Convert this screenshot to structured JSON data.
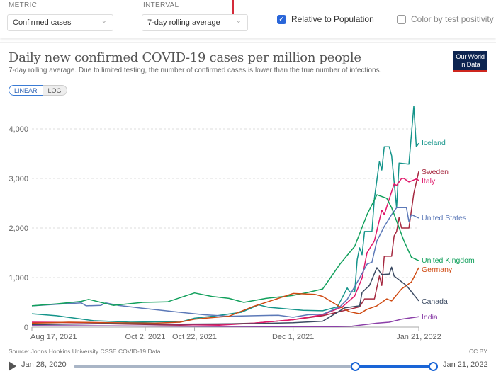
{
  "controls": {
    "metric_label": "METRIC",
    "metric_value": "Confirmed cases",
    "interval_label": "INTERVAL",
    "interval_value": "7-day rolling average",
    "relative_label": "Relative to Population",
    "relative_checked": true,
    "positivity_label": "Color by test positivity",
    "positivity_checked": false
  },
  "logo": {
    "line1": "Our World",
    "line2": "in Data"
  },
  "scale_toggle": {
    "linear": "LINEAR",
    "log": "LOG",
    "active": "LINEAR"
  },
  "footer": {
    "source": "Source: Johns Hopkins University CSSE COVID-19 Data",
    "license": "CC BY"
  },
  "timeline": {
    "start": "Jan 28, 2020",
    "end": "Jan 21, 2022",
    "selected_start": "Aug 17, 2021",
    "selected_end": "Jan 21, 2022"
  },
  "chart_data": {
    "type": "line",
    "title": "Daily new confirmed COVID-19 cases per million people",
    "subtitle": "7-day rolling average. Due to limited testing, the number of confirmed cases is lower than the true number of infections.",
    "xlim": [
      "2021-08-17",
      "2022-01-21"
    ],
    "ylim": [
      0,
      4500
    ],
    "yticks": [
      {
        "v": 0,
        "label": "0"
      },
      {
        "v": 1000,
        "label": "1,000"
      },
      {
        "v": 2000,
        "label": "2,000"
      },
      {
        "v": 3000,
        "label": "3,000"
      },
      {
        "v": 4000,
        "label": "4,000"
      }
    ],
    "xticks": [
      {
        "d": "2021-08-17",
        "label": "Aug 17, 2021"
      },
      {
        "d": "2021-10-02",
        "label": "Oct 2, 2021"
      },
      {
        "d": "2021-10-22",
        "label": "Oct 22, 2021"
      },
      {
        "d": "2021-12-01",
        "label": "Dec 1, 2021"
      },
      {
        "d": "2022-01-21",
        "label": "Jan 21, 2022"
      }
    ],
    "grid": true,
    "legend": "right (end labels)",
    "series": [
      {
        "name": "Iceland",
        "color": "#14948a",
        "points": [
          [
            "2021-08-17",
            270
          ],
          [
            "2021-08-27",
            230
          ],
          [
            "2021-09-11",
            130
          ],
          [
            "2021-09-26",
            100
          ],
          [
            "2021-10-11",
            110
          ],
          [
            "2021-10-16",
            100
          ],
          [
            "2021-10-22",
            180
          ],
          [
            "2021-10-31",
            230
          ],
          [
            "2021-11-10",
            300
          ],
          [
            "2021-11-17",
            450
          ],
          [
            "2021-11-21",
            400
          ],
          [
            "2021-12-05",
            340
          ],
          [
            "2021-12-13",
            330
          ],
          [
            "2021-12-19",
            410
          ],
          [
            "2021-12-23",
            790
          ],
          [
            "2021-12-24",
            710
          ],
          [
            "2021-12-26",
            710
          ],
          [
            "2021-12-27",
            1360
          ],
          [
            "2021-12-28",
            1600
          ],
          [
            "2021-12-29",
            1460
          ],
          [
            "2021-12-30",
            1930
          ],
          [
            "2022-01-02",
            1930
          ],
          [
            "2022-01-03",
            2600
          ],
          [
            "2022-01-05",
            3340
          ],
          [
            "2022-01-06",
            3170
          ],
          [
            "2022-01-07",
            3640
          ],
          [
            "2022-01-09",
            3640
          ],
          [
            "2022-01-10",
            3460
          ],
          [
            "2022-01-12",
            2410
          ],
          [
            "2022-01-13",
            3310
          ],
          [
            "2022-01-17",
            3290
          ],
          [
            "2022-01-19",
            4460
          ],
          [
            "2022-01-20",
            3640
          ],
          [
            "2022-01-21",
            3710
          ]
        ]
      },
      {
        "name": "Sweden",
        "color": "#a5283f",
        "points": [
          [
            "2021-08-17",
            60
          ],
          [
            "2021-09-16",
            70
          ],
          [
            "2021-10-16",
            40
          ],
          [
            "2021-11-15",
            80
          ],
          [
            "2021-12-01",
            150
          ],
          [
            "2021-12-13",
            230
          ],
          [
            "2021-12-28",
            410
          ],
          [
            "2021-12-30",
            570
          ],
          [
            "2022-01-03",
            570
          ],
          [
            "2022-01-05",
            1030
          ],
          [
            "2022-01-06",
            840
          ],
          [
            "2022-01-07",
            1430
          ],
          [
            "2022-01-10",
            1430
          ],
          [
            "2022-01-11",
            1840
          ],
          [
            "2022-01-12",
            1930
          ],
          [
            "2022-01-13",
            2210
          ],
          [
            "2022-01-14",
            2000
          ],
          [
            "2022-01-17",
            2000
          ],
          [
            "2022-01-19",
            2700
          ],
          [
            "2022-01-21",
            3140
          ]
        ]
      },
      {
        "name": "Italy",
        "color": "#e0186a",
        "points": [
          [
            "2021-08-17",
            100
          ],
          [
            "2021-09-16",
            90
          ],
          [
            "2021-10-16",
            50
          ],
          [
            "2021-11-01",
            40
          ],
          [
            "2021-11-15",
            80
          ],
          [
            "2021-12-01",
            150
          ],
          [
            "2021-12-13",
            250
          ],
          [
            "2021-12-21",
            410
          ],
          [
            "2021-12-26",
            630
          ],
          [
            "2021-12-29",
            990
          ],
          [
            "2021-12-31",
            1500
          ],
          [
            "2022-01-03",
            1740
          ],
          [
            "2022-01-06",
            2360
          ],
          [
            "2022-01-07",
            2270
          ],
          [
            "2022-01-11",
            2890
          ],
          [
            "2022-01-12",
            2860
          ],
          [
            "2022-01-14",
            3000
          ],
          [
            "2022-01-15",
            3000
          ],
          [
            "2022-01-17",
            2930
          ],
          [
            "2022-01-20",
            2990
          ],
          [
            "2022-01-21",
            2960
          ]
        ]
      },
      {
        "name": "United States",
        "color": "#5c79b8",
        "points": [
          [
            "2021-08-17",
            430
          ],
          [
            "2021-08-27",
            460
          ],
          [
            "2021-09-06",
            490
          ],
          [
            "2021-09-08",
            430
          ],
          [
            "2021-09-14",
            440
          ],
          [
            "2021-09-16",
            490
          ],
          [
            "2021-09-21",
            440
          ],
          [
            "2021-10-01",
            380
          ],
          [
            "2021-10-16",
            300
          ],
          [
            "2021-10-26",
            250
          ],
          [
            "2021-11-05",
            220
          ],
          [
            "2021-11-15",
            230
          ],
          [
            "2021-11-25",
            240
          ],
          [
            "2021-12-01",
            200
          ],
          [
            "2021-12-07",
            250
          ],
          [
            "2021-12-13",
            260
          ],
          [
            "2021-12-20",
            410
          ],
          [
            "2021-12-23",
            560
          ],
          [
            "2021-12-28",
            990
          ],
          [
            "2021-12-31",
            1270
          ],
          [
            "2022-01-02",
            1310
          ],
          [
            "2022-01-04",
            1740
          ],
          [
            "2022-01-07",
            2030
          ],
          [
            "2022-01-10",
            2270
          ],
          [
            "2022-01-12",
            2410
          ],
          [
            "2022-01-16",
            2410
          ],
          [
            "2022-01-17",
            2130
          ],
          [
            "2022-01-18",
            2270
          ],
          [
            "2022-01-21",
            2200
          ]
        ]
      },
      {
        "name": "United Kingdom",
        "color": "#12a05c",
        "points": [
          [
            "2021-08-17",
            430
          ],
          [
            "2021-08-27",
            470
          ],
          [
            "2021-09-06",
            520
          ],
          [
            "2021-09-09",
            560
          ],
          [
            "2021-09-14",
            500
          ],
          [
            "2021-09-19",
            440
          ],
          [
            "2021-10-01",
            500
          ],
          [
            "2021-10-11",
            510
          ],
          [
            "2021-10-22",
            690
          ],
          [
            "2021-10-29",
            620
          ],
          [
            "2021-11-05",
            580
          ],
          [
            "2021-11-11",
            500
          ],
          [
            "2021-11-20",
            580
          ],
          [
            "2021-12-01",
            640
          ],
          [
            "2021-12-07",
            700
          ],
          [
            "2021-12-13",
            770
          ],
          [
            "2021-12-20",
            1270
          ],
          [
            "2021-12-26",
            1630
          ],
          [
            "2021-12-31",
            2270
          ],
          [
            "2022-01-04",
            2670
          ],
          [
            "2022-01-08",
            2600
          ],
          [
            "2022-01-10",
            2410
          ],
          [
            "2022-01-15",
            1740
          ],
          [
            "2022-01-18",
            1410
          ],
          [
            "2022-01-21",
            1340
          ]
        ]
      },
      {
        "name": "Germany",
        "color": "#cf4a12",
        "points": [
          [
            "2021-08-17",
            80
          ],
          [
            "2021-09-01",
            100
          ],
          [
            "2021-09-16",
            90
          ],
          [
            "2021-10-06",
            80
          ],
          [
            "2021-10-16",
            100
          ],
          [
            "2021-10-22",
            160
          ],
          [
            "2021-10-31",
            200
          ],
          [
            "2021-11-05",
            220
          ],
          [
            "2021-11-15",
            420
          ],
          [
            "2021-11-25",
            580
          ],
          [
            "2021-12-01",
            680
          ],
          [
            "2021-12-10",
            660
          ],
          [
            "2021-12-13",
            620
          ],
          [
            "2021-12-16",
            530
          ],
          [
            "2021-12-20",
            410
          ],
          [
            "2021-12-24",
            310
          ],
          [
            "2021-12-28",
            270
          ],
          [
            "2021-12-31",
            360
          ],
          [
            "2022-01-04",
            430
          ],
          [
            "2022-01-08",
            570
          ],
          [
            "2022-01-10",
            530
          ],
          [
            "2022-01-14",
            770
          ],
          [
            "2022-01-18",
            910
          ],
          [
            "2022-01-21",
            1200
          ]
        ]
      },
      {
        "name": "Canada",
        "color": "#3b4a62",
        "points": [
          [
            "2021-08-17",
            50
          ],
          [
            "2021-09-16",
            70
          ],
          [
            "2021-10-16",
            60
          ],
          [
            "2021-11-15",
            70
          ],
          [
            "2021-12-01",
            90
          ],
          [
            "2021-12-13",
            120
          ],
          [
            "2021-12-22",
            390
          ],
          [
            "2021-12-28",
            430
          ],
          [
            "2021-12-29",
            700
          ],
          [
            "2022-01-01",
            840
          ],
          [
            "2022-01-04",
            1200
          ],
          [
            "2022-01-06",
            1060
          ],
          [
            "2022-01-09",
            1070
          ],
          [
            "2022-01-10",
            1210
          ],
          [
            "2022-01-11",
            1030
          ],
          [
            "2022-01-16",
            840
          ],
          [
            "2022-01-21",
            530
          ]
        ]
      },
      {
        "name": "India",
        "color": "#8b3fa8",
        "points": [
          [
            "2021-08-17",
            30
          ],
          [
            "2021-10-16",
            20
          ],
          [
            "2021-11-25",
            10
          ],
          [
            "2021-12-19",
            10
          ],
          [
            "2021-12-25",
            20
          ],
          [
            "2022-01-04",
            80
          ],
          [
            "2022-01-09",
            100
          ],
          [
            "2022-01-14",
            160
          ],
          [
            "2022-01-21",
            210
          ]
        ]
      }
    ]
  }
}
